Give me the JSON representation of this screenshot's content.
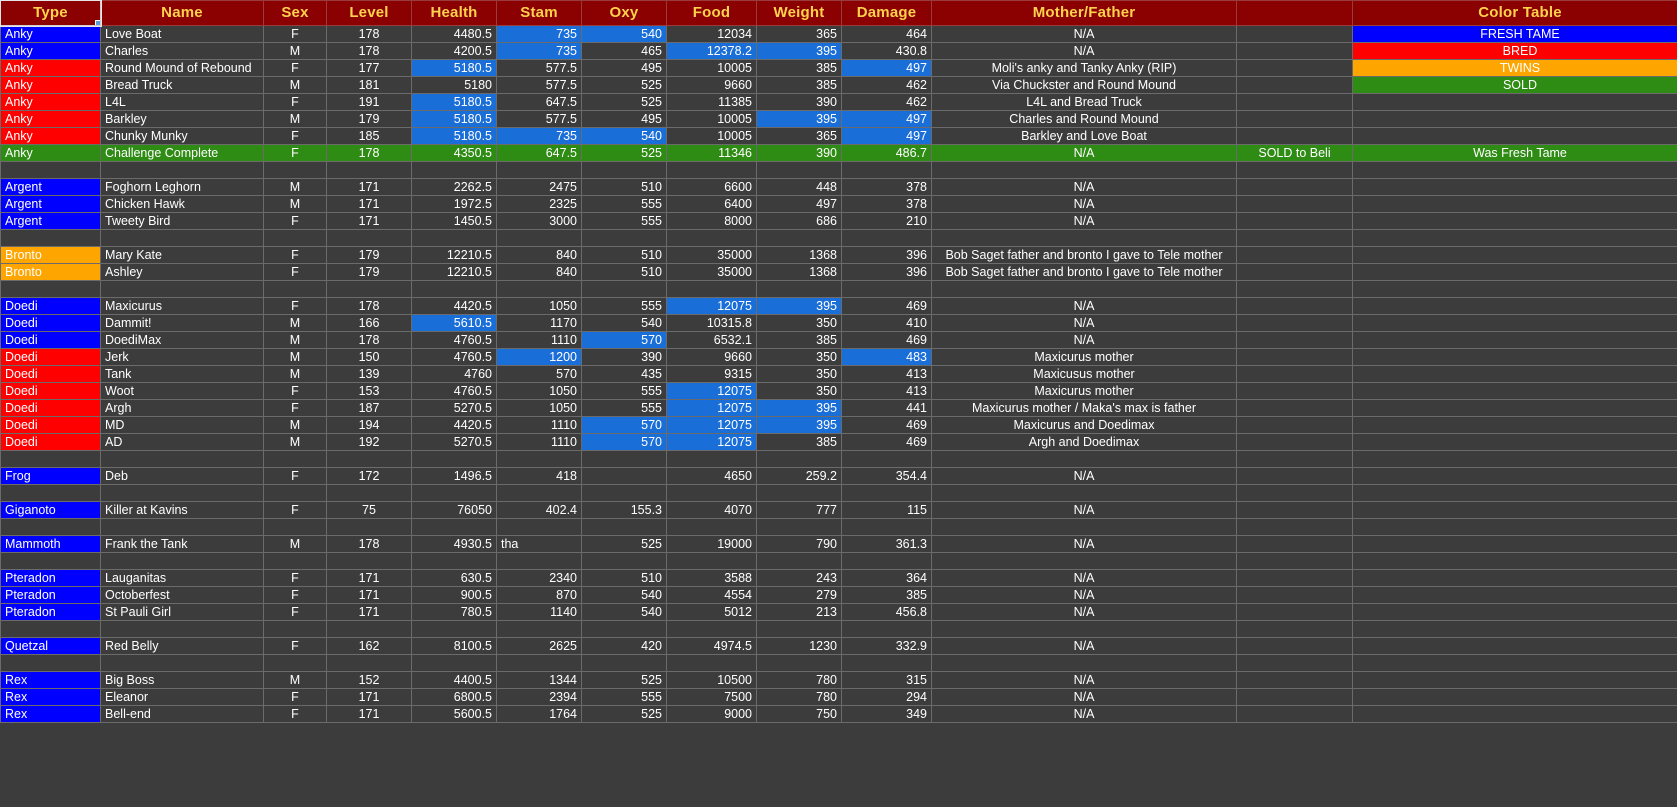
{
  "headers": {
    "type": "Type",
    "name": "Name",
    "sex": "Sex",
    "level": "Level",
    "health": "Health",
    "stam": "Stam",
    "oxy": "Oxy",
    "food": "Food",
    "weight": "Weight",
    "damage": "Damage",
    "mother_father": "Mother/Father",
    "note": "",
    "color_table": "Color Table"
  },
  "colors": {
    "header_bg": "#8b0000",
    "header_text": "#ffd24d",
    "cell_bg": "#3c3c3c",
    "grid": "#6b6b6b",
    "fresh_tame": "#0000ff",
    "bred": "#ff0000",
    "twins": "#ffa500",
    "sold": "#2e8b13",
    "highlight": "#1a6ed8"
  },
  "legend": [
    {
      "label": "FRESH TAME",
      "fill": "fresh"
    },
    {
      "label": "BRED",
      "fill": "bred"
    },
    {
      "label": "TWINS",
      "fill": "twins"
    },
    {
      "label": "SOLD",
      "fill": "sold"
    }
  ],
  "rows": [
    {
      "spacer": false,
      "type": "Anky",
      "typefill": "blue",
      "name": "Love Boat",
      "sex": "F",
      "level": "178",
      "health": "4480.5",
      "stam": "735",
      "oxy": "540",
      "food": "12034",
      "weight": "365",
      "damage": "464",
      "mf": "N/A",
      "note": "",
      "color": "FRESH TAME",
      "colorfill": "fresh",
      "hl": {
        "stam": true,
        "oxy": true
      }
    },
    {
      "spacer": false,
      "type": "Anky",
      "typefill": "blue",
      "name": "Charles",
      "sex": "M",
      "level": "178",
      "health": "4200.5",
      "stam": "735",
      "oxy": "465",
      "food": "12378.2",
      "weight": "395",
      "damage": "430.8",
      "mf": "N/A",
      "note": "",
      "color": "BRED",
      "colorfill": "bred",
      "hl": {
        "stam": true,
        "food": true,
        "weight": true
      }
    },
    {
      "spacer": false,
      "type": "Anky",
      "typefill": "red",
      "name": "Round Mound of Rebound",
      "sex": "F",
      "level": "177",
      "health": "5180.5",
      "stam": "577.5",
      "oxy": "495",
      "food": "10005",
      "weight": "385",
      "damage": "497",
      "mf": "Moli's anky and Tanky Anky (RIP)",
      "note": "",
      "color": "TWINS",
      "colorfill": "twins",
      "hl": {
        "health": true,
        "damage": true
      }
    },
    {
      "spacer": false,
      "type": "Anky",
      "typefill": "red",
      "name": "Bread Truck",
      "sex": "M",
      "level": "181",
      "health": "5180",
      "stam": "577.5",
      "oxy": "525",
      "food": "9660",
      "weight": "385",
      "damage": "462",
      "mf": "Via Chuckster and Round Mound",
      "note": "",
      "color": "SOLD",
      "colorfill": "sold",
      "hl": {}
    },
    {
      "spacer": false,
      "type": "Anky",
      "typefill": "red",
      "name": "L4L",
      "sex": "F",
      "level": "191",
      "health": "5180.5",
      "stam": "647.5",
      "oxy": "525",
      "food": "11385",
      "weight": "390",
      "damage": "462",
      "mf": "L4L and Bread Truck",
      "note": "",
      "color": "",
      "colorfill": "none",
      "hl": {
        "health": true
      }
    },
    {
      "spacer": false,
      "type": "Anky",
      "typefill": "red",
      "name": "Barkley",
      "sex": "M",
      "level": "179",
      "health": "5180.5",
      "stam": "577.5",
      "oxy": "495",
      "food": "10005",
      "weight": "395",
      "damage": "497",
      "mf": "Charles and Round Mound",
      "note": "",
      "color": "",
      "colorfill": "none",
      "hl": {
        "health": true,
        "weight": true,
        "damage": true
      }
    },
    {
      "spacer": false,
      "type": "Anky",
      "typefill": "red",
      "name": "Chunky Munky",
      "sex": "F",
      "level": "185",
      "health": "5180.5",
      "stam": "735",
      "oxy": "540",
      "food": "10005",
      "weight": "365",
      "damage": "497",
      "mf": "Barkley and Love Boat",
      "note": "",
      "color": "",
      "colorfill": "none",
      "hl": {
        "health": true,
        "stam": true,
        "oxy": true,
        "damage": true
      }
    },
    {
      "spacer": false,
      "rowfill": "green",
      "type": "Anky",
      "typefill": "green",
      "name": "Challenge Complete",
      "sex": "F",
      "level": "178",
      "health": "4350.5",
      "stam": "647.5",
      "oxy": "525",
      "food": "11346",
      "weight": "390",
      "damage": "486.7",
      "mf": "N/A",
      "note": "SOLD to Beli",
      "color": "Was Fresh Tame",
      "colorfill": "none",
      "hl": {}
    },
    {
      "spacer": true
    },
    {
      "spacer": false,
      "type": "Argent",
      "typefill": "blue",
      "name": "Foghorn Leghorn",
      "sex": "M",
      "level": "171",
      "health": "2262.5",
      "stam": "2475",
      "oxy": "510",
      "food": "6600",
      "weight": "448",
      "damage": "378",
      "mf": "N/A",
      "note": "",
      "color": "",
      "colorfill": "none",
      "hl": {}
    },
    {
      "spacer": false,
      "type": "Argent",
      "typefill": "blue",
      "name": "Chicken Hawk",
      "sex": "M",
      "level": "171",
      "health": "1972.5",
      "stam": "2325",
      "oxy": "555",
      "food": "6400",
      "weight": "497",
      "damage": "378",
      "mf": "N/A",
      "note": "",
      "color": "",
      "colorfill": "none",
      "hl": {}
    },
    {
      "spacer": false,
      "type": "Argent",
      "typefill": "blue",
      "name": "Tweety Bird",
      "sex": "F",
      "level": "171",
      "health": "1450.5",
      "stam": "3000",
      "oxy": "555",
      "food": "8000",
      "weight": "686",
      "damage": "210",
      "mf": "N/A",
      "note": "",
      "color": "",
      "colorfill": "none",
      "hl": {}
    },
    {
      "spacer": true
    },
    {
      "spacer": false,
      "type": "Bronto",
      "typefill": "orange",
      "name": "Mary Kate",
      "sex": "F",
      "level": "179",
      "health": "12210.5",
      "stam": "840",
      "oxy": "510",
      "food": "35000",
      "weight": "1368",
      "damage": "396",
      "mf": "Bob Saget father and bronto I gave to Tele mother",
      "note": "",
      "color": "",
      "colorfill": "none",
      "hl": {}
    },
    {
      "spacer": false,
      "type": "Bronto",
      "typefill": "orange",
      "name": "Ashley",
      "sex": "F",
      "level": "179",
      "health": "12210.5",
      "stam": "840",
      "oxy": "510",
      "food": "35000",
      "weight": "1368",
      "damage": "396",
      "mf": "Bob Saget father and bronto I gave to Tele mother",
      "note": "",
      "color": "",
      "colorfill": "none",
      "hl": {}
    },
    {
      "spacer": true
    },
    {
      "spacer": false,
      "type": "Doedi",
      "typefill": "blue",
      "name": "Maxicurus",
      "sex": "F",
      "level": "178",
      "health": "4420.5",
      "stam": "1050",
      "oxy": "555",
      "food": "12075",
      "weight": "395",
      "damage": "469",
      "mf": "N/A",
      "note": "",
      "color": "",
      "colorfill": "none",
      "hl": {
        "food": true,
        "weight": true
      }
    },
    {
      "spacer": false,
      "type": "Doedi",
      "typefill": "blue",
      "name": "Dammit!",
      "sex": "M",
      "level": "166",
      "health": "5610.5",
      "stam": "1170",
      "oxy": "540",
      "food": "10315.8",
      "weight": "350",
      "damage": "410",
      "mf": "N/A",
      "note": "",
      "color": "",
      "colorfill": "none",
      "hl": {
        "health": true
      }
    },
    {
      "spacer": false,
      "type": "Doedi",
      "typefill": "blue",
      "name": "DoediMax",
      "sex": "M",
      "level": "178",
      "health": "4760.5",
      "stam": "1110",
      "oxy": "570",
      "food": "6532.1",
      "weight": "385",
      "damage": "469",
      "mf": "N/A",
      "note": "",
      "color": "",
      "colorfill": "none",
      "hl": {
        "oxy": true
      }
    },
    {
      "spacer": false,
      "type": "Doedi",
      "typefill": "red",
      "name": "Jerk",
      "sex": "M",
      "level": "150",
      "health": "4760.5",
      "stam": "1200",
      "oxy": "390",
      "food": "9660",
      "weight": "350",
      "damage": "483",
      "mf": "Maxicurus mother",
      "note": "",
      "color": "",
      "colorfill": "none",
      "hl": {
        "stam": true,
        "damage": true
      }
    },
    {
      "spacer": false,
      "type": "Doedi",
      "typefill": "red",
      "name": "Tank",
      "sex": "M",
      "level": "139",
      "health": "4760",
      "stam": "570",
      "oxy": "435",
      "food": "9315",
      "weight": "350",
      "damage": "413",
      "mf": "Maxicusus mother",
      "note": "",
      "color": "",
      "colorfill": "none",
      "hl": {}
    },
    {
      "spacer": false,
      "type": "Doedi",
      "typefill": "red",
      "name": "Woot",
      "sex": "F",
      "level": "153",
      "health": "4760.5",
      "stam": "1050",
      "oxy": "555",
      "food": "12075",
      "weight": "350",
      "damage": "413",
      "mf": "Maxicurus mother",
      "note": "",
      "color": "",
      "colorfill": "none",
      "hl": {
        "food": true
      }
    },
    {
      "spacer": false,
      "type": "Doedi",
      "typefill": "red",
      "name": "Argh",
      "sex": "F",
      "level": "187",
      "health": "5270.5",
      "stam": "1050",
      "oxy": "555",
      "food": "12075",
      "weight": "395",
      "damage": "441",
      "mf": "Maxicurus mother / Maka's max is father",
      "note": "",
      "color": "",
      "colorfill": "none",
      "hl": {
        "food": true,
        "weight": true
      }
    },
    {
      "spacer": false,
      "type": "Doedi",
      "typefill": "red",
      "name": "MD",
      "sex": "M",
      "level": "194",
      "health": "4420.5",
      "stam": "1110",
      "oxy": "570",
      "food": "12075",
      "weight": "395",
      "damage": "469",
      "mf": "Maxicurus and Doedimax",
      "note": "",
      "color": "",
      "colorfill": "none",
      "hl": {
        "oxy": true,
        "food": true,
        "weight": true
      }
    },
    {
      "spacer": false,
      "type": "Doedi",
      "typefill": "red",
      "name": "AD",
      "sex": "M",
      "level": "192",
      "health": "5270.5",
      "stam": "1110",
      "oxy": "570",
      "food": "12075",
      "weight": "385",
      "damage": "469",
      "mf": "Argh and Doedimax",
      "note": "",
      "color": "",
      "colorfill": "none",
      "hl": {
        "oxy": true,
        "food": true
      }
    },
    {
      "spacer": true
    },
    {
      "spacer": false,
      "type": "Frog",
      "typefill": "blue",
      "name": "Deb",
      "sex": "F",
      "level": "172",
      "health": "1496.5",
      "stam": "418",
      "oxy": "",
      "food": "4650",
      "weight": "259.2",
      "damage": "354.4",
      "mf": "N/A",
      "note": "",
      "color": "",
      "colorfill": "none",
      "hl": {}
    },
    {
      "spacer": true
    },
    {
      "spacer": false,
      "type": "Giganoto",
      "typefill": "blue",
      "name": "Killer at Kavins",
      "sex": "F",
      "level": "75",
      "health": "76050",
      "stam": "402.4",
      "oxy": "155.3",
      "food": "4070",
      "weight": "777",
      "damage": "115",
      "mf": "N/A",
      "note": "",
      "color": "",
      "colorfill": "none",
      "hl": {}
    },
    {
      "spacer": true
    },
    {
      "spacer": false,
      "type": "Mammoth",
      "typefill": "blue",
      "name": "Frank the Tank",
      "sex": "M",
      "level": "178",
      "health": "4930.5",
      "stam": "tha",
      "stam_left": true,
      "oxy": "525",
      "food": "19000",
      "weight": "790",
      "damage": "361.3",
      "mf": "N/A",
      "note": "",
      "color": "",
      "colorfill": "none",
      "hl": {}
    },
    {
      "spacer": true
    },
    {
      "spacer": false,
      "type": "Pteradon",
      "typefill": "blue",
      "name": "Lauganitas",
      "sex": "F",
      "level": "171",
      "health": "630.5",
      "stam": "2340",
      "oxy": "510",
      "food": "3588",
      "weight": "243",
      "damage": "364",
      "mf": "N/A",
      "note": "",
      "color": "",
      "colorfill": "none",
      "hl": {}
    },
    {
      "spacer": false,
      "type": "Pteradon",
      "typefill": "blue",
      "name": "Octoberfest",
      "sex": "F",
      "level": "171",
      "health": "900.5",
      "stam": "870",
      "oxy": "540",
      "food": "4554",
      "weight": "279",
      "damage": "385",
      "mf": "N/A",
      "note": "",
      "color": "",
      "colorfill": "none",
      "hl": {}
    },
    {
      "spacer": false,
      "type": "Pteradon",
      "typefill": "blue",
      "name": "St Pauli Girl",
      "sex": "F",
      "level": "171",
      "health": "780.5",
      "stam": "1140",
      "oxy": "540",
      "food": "5012",
      "weight": "213",
      "damage": "456.8",
      "mf": "N/A",
      "note": "",
      "color": "",
      "colorfill": "none",
      "hl": {}
    },
    {
      "spacer": true
    },
    {
      "spacer": false,
      "type": "Quetzal",
      "typefill": "blue",
      "name": "Red Belly",
      "sex": "F",
      "level": "162",
      "health": "8100.5",
      "stam": "2625",
      "oxy": "420",
      "food": "4974.5",
      "weight": "1230",
      "damage": "332.9",
      "mf": "N/A",
      "note": "",
      "color": "",
      "colorfill": "none",
      "hl": {}
    },
    {
      "spacer": true
    },
    {
      "spacer": false,
      "type": "Rex",
      "typefill": "blue",
      "name": "Big Boss",
      "sex": "M",
      "level": "152",
      "health": "4400.5",
      "stam": "1344",
      "oxy": "525",
      "food": "10500",
      "weight": "780",
      "damage": "315",
      "mf": "N/A",
      "note": "",
      "color": "",
      "colorfill": "none",
      "hl": {}
    },
    {
      "spacer": false,
      "type": "Rex",
      "typefill": "blue",
      "name": "Eleanor",
      "sex": "F",
      "level": "171",
      "health": "6800.5",
      "stam": "2394",
      "oxy": "555",
      "food": "7500",
      "weight": "780",
      "damage": "294",
      "mf": "N/A",
      "note": "",
      "color": "",
      "colorfill": "none",
      "hl": {}
    },
    {
      "spacer": false,
      "type": "Rex",
      "typefill": "blue",
      "name": "Bell-end",
      "sex": "F",
      "level": "171",
      "health": "5600.5",
      "stam": "1764",
      "oxy": "525",
      "food": "9000",
      "weight": "750",
      "damage": "349",
      "mf": "N/A",
      "note": "",
      "color": "",
      "colorfill": "none",
      "hl": {}
    }
  ]
}
